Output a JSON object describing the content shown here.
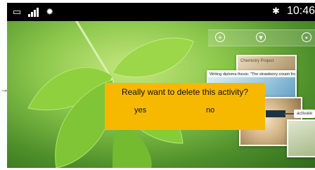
{
  "status_bar": {
    "time": "10:46",
    "icons": [
      "battery-icon",
      "signal-icon",
      "notification-icon",
      "bluetooth-icon"
    ]
  },
  "activity_panel": {
    "buttons": [
      "add-icon",
      "filter-icon",
      "grid-icon"
    ]
  },
  "cards": {
    "card1_caption": "Chemistry Project",
    "card2_caption": "Writing diploma thesis: \"The strawberry cream frog in danger\""
  },
  "activate_label": "activate",
  "dialog": {
    "message": "Really want to delete this activity?",
    "yes_label": "yes",
    "no_label": "no",
    "background": "#f7b800"
  }
}
